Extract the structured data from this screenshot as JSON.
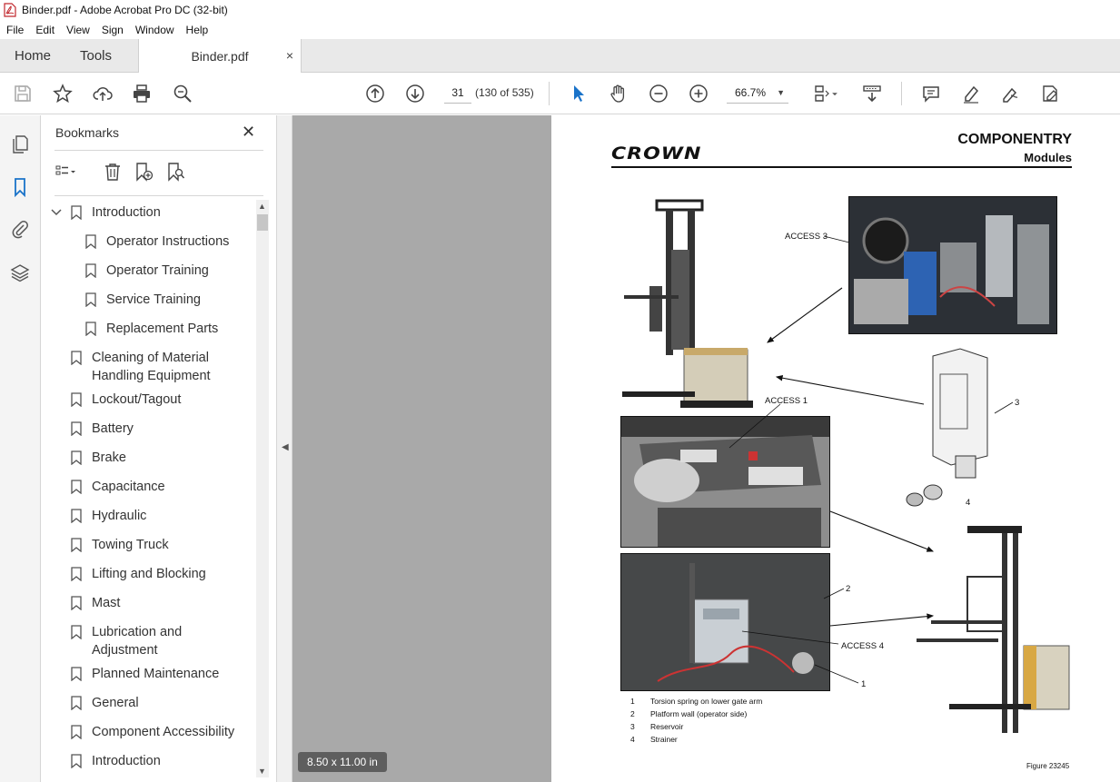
{
  "window": {
    "title": "Binder.pdf - Adobe Acrobat Pro DC (32-bit)"
  },
  "menu": [
    "File",
    "Edit",
    "View",
    "Sign",
    "Window",
    "Help"
  ],
  "tabs": {
    "home": "Home",
    "tools": "Tools",
    "doc": "Binder.pdf",
    "close": "×"
  },
  "toolbar": {
    "page_number": "31",
    "page_count": "(130 of 535)",
    "zoom": "66.7%",
    "zoom_caret": "▼"
  },
  "bookmarks": {
    "title": "Bookmarks",
    "close": "✕",
    "items": [
      {
        "label": "Introduction",
        "expanded": true,
        "level": 0
      },
      {
        "label": "Operator Instructions",
        "level": 1
      },
      {
        "label": "Operator Training",
        "level": 1
      },
      {
        "label": "Service Training",
        "level": 1
      },
      {
        "label": "Replacement Parts",
        "level": 1
      },
      {
        "label": "Cleaning of Material Handling Equipment",
        "level": 0
      },
      {
        "label": "Lockout/Tagout",
        "level": 0
      },
      {
        "label": "Battery",
        "level": 0
      },
      {
        "label": "Brake",
        "level": 0
      },
      {
        "label": "Capacitance",
        "level": 0
      },
      {
        "label": "Hydraulic",
        "level": 0
      },
      {
        "label": "Towing Truck",
        "level": 0
      },
      {
        "label": "Lifting and Blocking",
        "level": 0
      },
      {
        "label": "Mast",
        "level": 0
      },
      {
        "label": "Lubrication and Adjustment",
        "level": 0
      },
      {
        "label": "Planned Maintenance",
        "level": 0
      },
      {
        "label": "General",
        "level": 0
      },
      {
        "label": "Component Accessibility",
        "level": 0
      },
      {
        "label": "Introduction",
        "level": 0
      }
    ]
  },
  "document": {
    "page_size": "8.50 x 11.00 in",
    "logo": "CROWN",
    "heading": "COMPONENTRY",
    "subheading": "Modules",
    "callouts": {
      "access3": "ACCESS 3",
      "access1": "ACCESS 1",
      "access4": "ACCESS 4",
      "n3": "3",
      "n4": "4",
      "n2": "2",
      "n1": "1"
    },
    "legend": [
      {
        "n": "1",
        "text": "Torsion spring on lower gate arm"
      },
      {
        "n": "2",
        "text": "Platform wall (operator side)"
      },
      {
        "n": "3",
        "text": "Reservoir"
      },
      {
        "n": "4",
        "text": "Strainer"
      }
    ],
    "figure": "Figure 23245"
  }
}
